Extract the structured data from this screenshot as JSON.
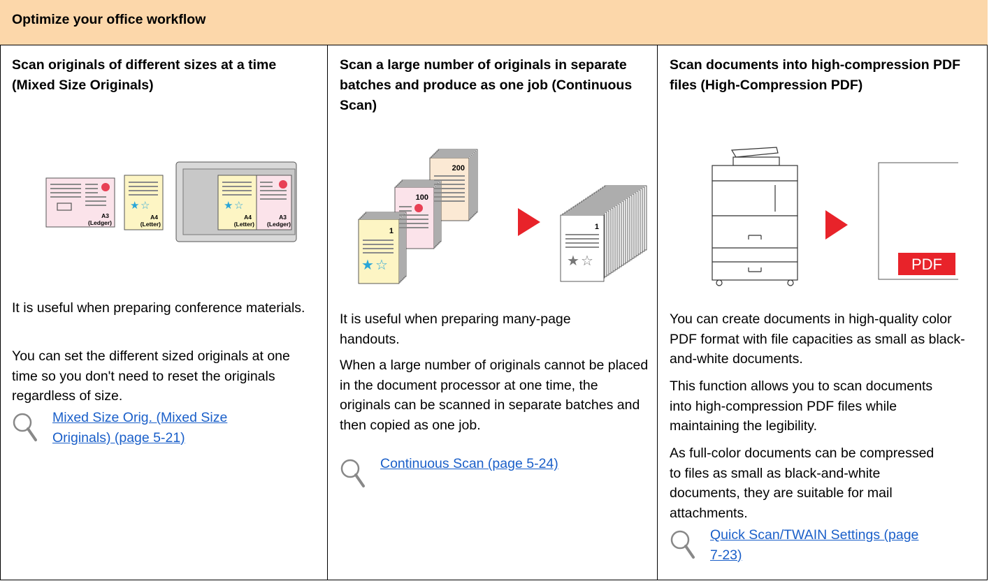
{
  "header": {
    "title": "Optimize your office workflow"
  },
  "columns": [
    {
      "title": "Scan originals of different sizes at a time (Mixed Size Originals)",
      "illustration": {
        "a3_label": "A3",
        "ledger_label": "(Ledger)",
        "a4_label": "A4",
        "letter_label": "(Letter)"
      },
      "paragraphs": [
        "It is useful when preparing conference materials.",
        "You can set the different sized originals at one time so you don't need to reset the originals regardless of size."
      ],
      "link_lines": [
        "Mixed Size Orig. (Mixed Size ",
        "Originals) (page 5-21)"
      ]
    },
    {
      "title": "Scan a large number of originals in separate batches and produce as one job (Continuous Scan)",
      "illustration": {
        "stack1": "1",
        "stack2": "100",
        "stack3": "200",
        "result": "1"
      },
      "paragraphs": [
        "It is useful when preparing many-page handouts.",
        "When a large number of originals cannot be placed in the document processor at one time, the originals can be scanned in separate batches and then copied as one job."
      ],
      "link_lines": [
        "Continuous Scan (page 5-24)"
      ]
    },
    {
      "title": "Scan documents into high-compression PDF files (High-Compression PDF)",
      "illustration": {
        "pdf_label": "PDF"
      },
      "paragraphs": [
        "You can create documents in high-quality color PDF format with file capacities as small as black-and-white documents.",
        "This function allows you to scan documents into high-compression PDF files while maintaining the legibility.",
        "As full-color documents can be compressed to files as small as black-and-white documents, they are suitable for mail attachments."
      ],
      "link_lines": [
        "Quick Scan/TWAIN Settings (page ",
        "7-23)"
      ]
    }
  ],
  "colors": {
    "header_bg": "#fcd7aa",
    "link": "#1a5fc9",
    "arrow": "#e8232a",
    "pink_doc": "#fbe3ea",
    "yellow_doc": "#fdf5c4",
    "cream_doc": "#fbe9d4"
  }
}
